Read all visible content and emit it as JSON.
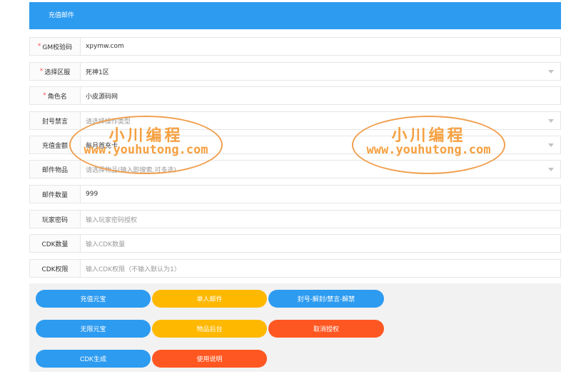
{
  "header": {
    "title": "充值邮件"
  },
  "form": {
    "gm_code": {
      "label": "GM校验码",
      "required": true,
      "value": "xpymw.com"
    },
    "server": {
      "label": "选择区服",
      "required": true,
      "value": "死神1区"
    },
    "role": {
      "label": "角色名",
      "required": true,
      "value": "小皮源码网"
    },
    "ban": {
      "label": "封号禁言",
      "placeholder": "请选择操作类型"
    },
    "amount": {
      "label": "充值金额",
      "value": "每月首充卡"
    },
    "mail_item": {
      "label": "邮件物品",
      "placeholder": "请选择物品(输入即搜索,可多选)"
    },
    "mail_count": {
      "label": "邮件数量",
      "value": "999"
    },
    "player_pwd": {
      "label": "玩家密码",
      "placeholder": "输入玩家密码授权"
    },
    "cdk_count": {
      "label": "CDK数量",
      "placeholder": "输入CDK数量"
    },
    "cdk_perm": {
      "label": "CDK权限",
      "placeholder": "输入CDK权限（不输入默认为1）"
    }
  },
  "buttons": {
    "recharge_yb": "充值元宝",
    "single_mail": "单人邮件",
    "ban_unban": "封号-解封/禁言-解禁",
    "unlimited_yb": "无限元宝",
    "item_backend": "物品后台",
    "cancel_auth": "取消授权",
    "cdk_generate": "CDK生成",
    "instructions": "使用说明"
  },
  "watermark": {
    "title": "小川编程",
    "url": "www.youhutong.com"
  },
  "colors": {
    "blue": "#2d9bf0",
    "yellow": "#ffb800",
    "orange": "#ff5722",
    "required": "#ff4d4f"
  }
}
